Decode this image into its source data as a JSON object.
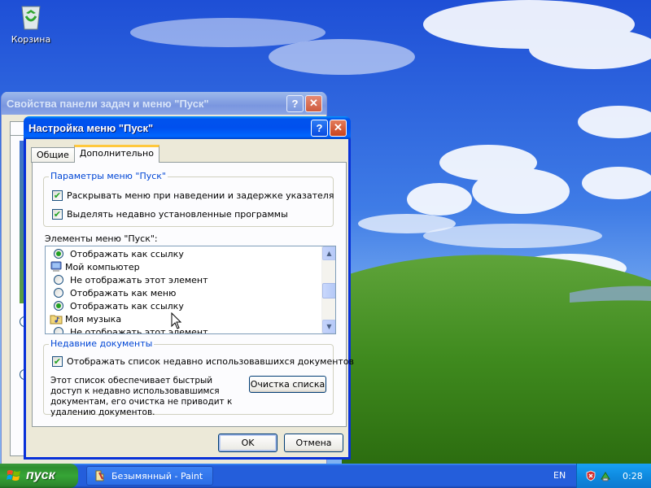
{
  "desktop": {
    "recycle_bin_label": "Корзина"
  },
  "back_window": {
    "title": "Свойства панели задач и меню \"Пуск\"",
    "help_glyph": "?",
    "close_glyph": "✕"
  },
  "dialog": {
    "title": "Настройка меню \"Пуск\"",
    "help_glyph": "?",
    "close_glyph": "✕",
    "tabs": [
      {
        "label": "Общие",
        "active": false
      },
      {
        "label": "Дополнительно",
        "active": true
      }
    ],
    "start_menu_settings": {
      "legend": "Параметры меню \"Пуск\"",
      "options": [
        {
          "label": "Раскрывать меню при наведении и задержке указателя",
          "checked": true
        },
        {
          "label": "Выделять недавно установленные программы",
          "checked": true
        }
      ]
    },
    "items_label": "Элементы меню \"Пуск\":",
    "items_list": [
      {
        "kind": "radio",
        "label": "Отображать как ссылку",
        "selected": true
      },
      {
        "kind": "header",
        "icon": "my-computer-icon",
        "label": "Мой компьютер"
      },
      {
        "kind": "radio",
        "label": "Не отображать этот элемент",
        "selected": false
      },
      {
        "kind": "radio",
        "label": "Отображать как меню",
        "selected": false
      },
      {
        "kind": "radio",
        "label": "Отображать как ссылку",
        "selected": true
      },
      {
        "kind": "header",
        "icon": "my-music-icon",
        "label": "Моя музыка"
      },
      {
        "kind": "radio",
        "label": "Не отображать этот элемент",
        "selected": false
      }
    ],
    "recent_docs": {
      "legend": "Недавние документы",
      "checkbox_label": "Отображать список недавно использовавшихся документов",
      "checked": true,
      "description": "Этот список обеспечивает быстрый доступ к недавно использовавшимся документам, его очистка не приводит к удалению документов.",
      "clear_button": "Очистка списка"
    },
    "ok_button": "OK",
    "cancel_button": "Отмена"
  },
  "taskbar": {
    "start_label": "пуск",
    "task_paint_label": "Безымянный - Paint",
    "language": "EN",
    "clock": "0:28"
  },
  "colors": {
    "xp_blue": "#0054e3",
    "start_green": "#36a536",
    "group_legend_blue": "#0046d5",
    "check_green": "#21a121"
  }
}
